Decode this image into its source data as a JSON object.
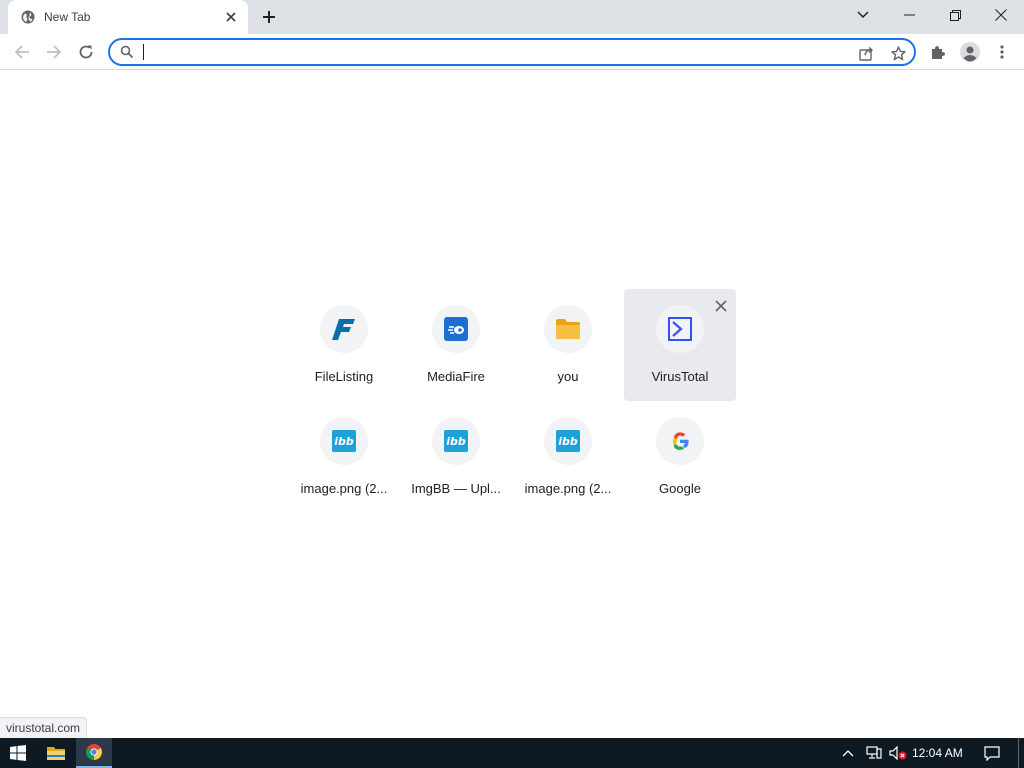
{
  "tab": {
    "title": "New Tab"
  },
  "omnibox": {
    "value": "",
    "placeholder": ""
  },
  "shortcuts": [
    {
      "label": "FileListing",
      "icon": "filelisting-icon"
    },
    {
      "label": "MediaFire",
      "icon": "mediafire-icon"
    },
    {
      "label": "you",
      "icon": "folder-icon"
    },
    {
      "label": "VirusTotal",
      "icon": "virustotal-icon"
    },
    {
      "label": "image.png (2...",
      "icon": "imgbb-icon",
      "badge": "ibb"
    },
    {
      "label": "ImgBB — Upl...",
      "icon": "imgbb-icon",
      "badge": "ibb"
    },
    {
      "label": "image.png (2...",
      "icon": "imgbb-icon",
      "badge": "ibb"
    },
    {
      "label": "Google",
      "icon": "google-icon"
    }
  ],
  "status": {
    "url": "virustotal.com"
  },
  "taskbar": {
    "time": "12:04 AM"
  },
  "colors": {
    "accent": "#1a73e8",
    "tabstrip": "#dee1e6",
    "taskbar": "#0d1a24"
  }
}
